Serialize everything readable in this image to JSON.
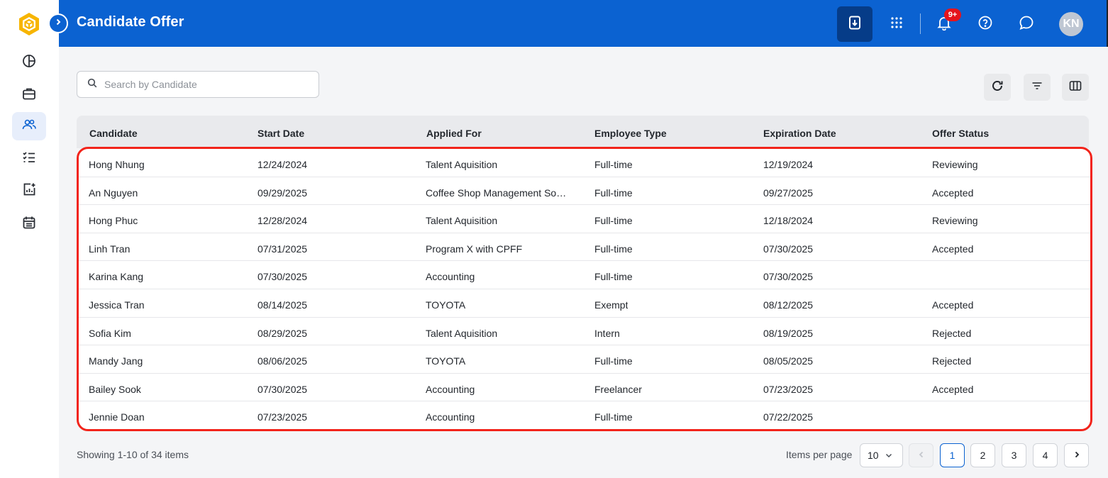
{
  "header": {
    "title": "Candidate Offer",
    "notification_badge": "9+",
    "avatar_initials": "KN",
    "brand_color": "#0b62d1"
  },
  "sidebar": {
    "items": [
      {
        "icon": "pie-chart-icon"
      },
      {
        "icon": "briefcase-icon"
      },
      {
        "icon": "users-icon",
        "active": true
      },
      {
        "icon": "task-list-icon"
      },
      {
        "icon": "add-report-icon"
      },
      {
        "icon": "calendar-icon"
      }
    ]
  },
  "search": {
    "placeholder": "Search by Candidate",
    "value": ""
  },
  "table": {
    "columns": [
      "Candidate",
      "Start Date",
      "Applied For",
      "Employee Type",
      "Expiration Date",
      "Offer Status"
    ],
    "rows": [
      {
        "candidate": "Hong Nhung",
        "start_date": "12/24/2024",
        "applied_for": "Talent Aquisition",
        "employee_type": "Full-time",
        "expiration_date": "12/19/2024",
        "offer_status": "Reviewing"
      },
      {
        "candidate": "An Nguyen",
        "start_date": "09/29/2025",
        "applied_for": "Coffee Shop Management So…",
        "employee_type": "Full-time",
        "expiration_date": "09/27/2025",
        "offer_status": "Accepted"
      },
      {
        "candidate": "Hong Phuc",
        "start_date": "12/28/2024",
        "applied_for": "Talent Aquisition",
        "employee_type": "Full-time",
        "expiration_date": "12/18/2024",
        "offer_status": "Reviewing"
      },
      {
        "candidate": "Linh Tran",
        "start_date": "07/31/2025",
        "applied_for": "Program X with CPFF",
        "employee_type": "Full-time",
        "expiration_date": "07/30/2025",
        "offer_status": "Accepted"
      },
      {
        "candidate": "Karina Kang",
        "start_date": "07/30/2025",
        "applied_for": "Accounting",
        "employee_type": "Full-time",
        "expiration_date": "07/30/2025",
        "offer_status": ""
      },
      {
        "candidate": "Jessica Tran",
        "start_date": "08/14/2025",
        "applied_for": "TOYOTA",
        "employee_type": "Exempt",
        "expiration_date": "08/12/2025",
        "offer_status": "Accepted"
      },
      {
        "candidate": "Sofia Kim",
        "start_date": "08/29/2025",
        "applied_for": "Talent Aquisition",
        "employee_type": "Intern",
        "expiration_date": "08/19/2025",
        "offer_status": "Rejected"
      },
      {
        "candidate": "Mandy Jang",
        "start_date": "08/06/2025",
        "applied_for": "TOYOTA",
        "employee_type": "Full-time",
        "expiration_date": "08/05/2025",
        "offer_status": "Rejected"
      },
      {
        "candidate": "Bailey Sook",
        "start_date": "07/30/2025",
        "applied_for": "Accounting",
        "employee_type": "Freelancer",
        "expiration_date": "07/23/2025",
        "offer_status": "Accepted"
      },
      {
        "candidate": "Jennie Doan",
        "start_date": "07/23/2025",
        "applied_for": "Accounting",
        "employee_type": "Full-time",
        "expiration_date": "07/22/2025",
        "offer_status": ""
      }
    ]
  },
  "footer": {
    "showing": "Showing 1-10 of 34 items",
    "items_per_page_label": "Items per page",
    "items_per_page_value": "10",
    "pages": [
      "1",
      "2",
      "3",
      "4"
    ],
    "current_page": "1"
  }
}
